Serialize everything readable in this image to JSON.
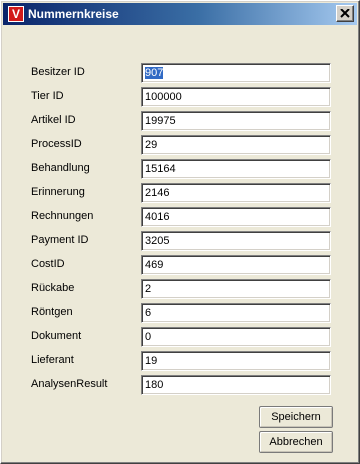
{
  "window": {
    "title": "Nummernkreise",
    "icon_letter": "V"
  },
  "fields": [
    {
      "label": "Besitzer ID",
      "value": "907"
    },
    {
      "label": "Tier ID",
      "value": "100000"
    },
    {
      "label": "Artikel ID",
      "value": "19975"
    },
    {
      "label": "ProcessID",
      "value": "29"
    },
    {
      "label": "Behandlung",
      "value": "15164"
    },
    {
      "label": "Erinnerung",
      "value": "2146"
    },
    {
      "label": "Rechnungen",
      "value": "4016"
    },
    {
      "label": "Payment ID",
      "value": "3205"
    },
    {
      "label": "CostID",
      "value": "469"
    },
    {
      "label": "Rückabe",
      "value": "2"
    },
    {
      "label": "Röntgen",
      "value": "6"
    },
    {
      "label": "Dokument",
      "value": "0"
    },
    {
      "label": "Lieferant",
      "value": "19"
    },
    {
      "label": "AnalysenResult",
      "value": "180"
    }
  ],
  "buttons": {
    "save": "Speichern",
    "cancel": "Abbrechen"
  }
}
